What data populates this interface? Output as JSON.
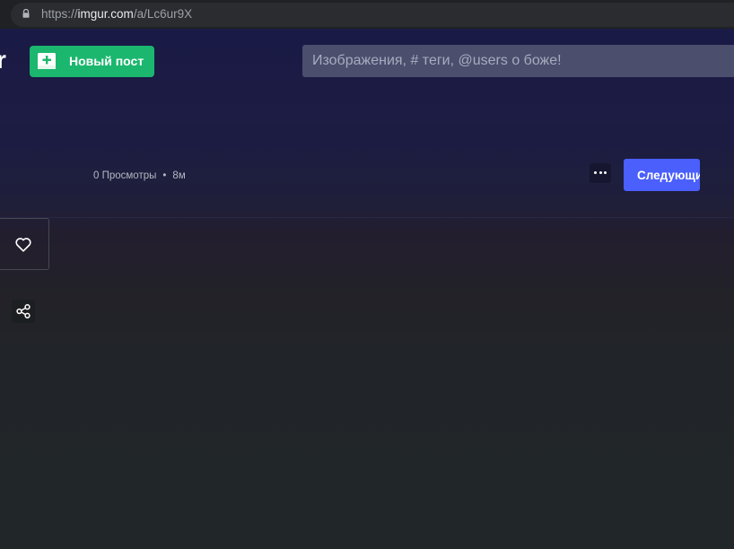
{
  "browser": {
    "url_scheme": "https://",
    "url_host": "imgur.com",
    "url_path": "/a/Lc6ur9X"
  },
  "header": {
    "logo_partial": "r",
    "new_post_label": "Новый пост",
    "search_placeholder": "Изображения, # теги, @users о боже!"
  },
  "post": {
    "views": "0 Просмотры",
    "separator": "•",
    "age": "8м",
    "next_label": "Следующий"
  },
  "icons": {
    "lock": "lock-icon",
    "plus": "plus-icon",
    "more": "more-horizontal-icon",
    "heart": "heart-icon",
    "share": "share-icon"
  },
  "colors": {
    "new_post_green": "#1bb76e",
    "next_blue": "#4a5ffc",
    "header_navy": "#1a1a46",
    "body_dark": "#212529"
  }
}
